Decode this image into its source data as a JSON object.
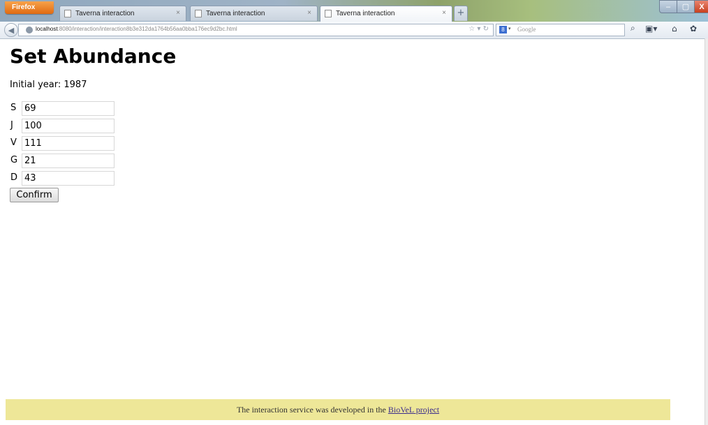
{
  "browser": {
    "app_menu_label": "Firefox",
    "tabs": [
      {
        "label": "Taverna interaction",
        "close": "×"
      },
      {
        "label": "Taverna interaction",
        "close": "×"
      },
      {
        "label": "Taverna interaction",
        "close": "×",
        "active": true
      }
    ],
    "new_tab": "+",
    "url_host": "localhost",
    "url_rest": ":8080/interaction/interaction8b3e312da1764b56aa0bba176ec9d2bc.html",
    "search_placeholder": "Google",
    "search_engine": "8",
    "window": {
      "minimize": "–",
      "maximize": "▢",
      "close": "X"
    }
  },
  "page": {
    "title": "Set Abundance",
    "initial_year": "Initial year: 1987",
    "rows": [
      {
        "label": "S",
        "value": "69"
      },
      {
        "label": "J",
        "value": "100"
      },
      {
        "label": "V",
        "value": "111"
      },
      {
        "label": "G",
        "value": "21"
      },
      {
        "label": "D",
        "value": "43"
      }
    ],
    "confirm_label": "Confirm"
  },
  "footer": {
    "text": "The interaction service was developed in the ",
    "link": "BioVeL project"
  },
  "colors": {
    "footer_bg": "#eee798",
    "link": "#3a2b8c"
  }
}
